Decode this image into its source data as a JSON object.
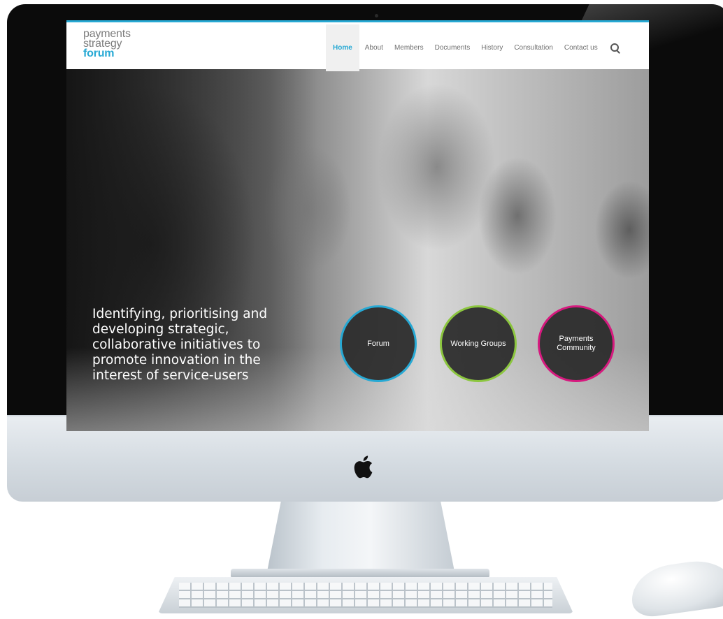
{
  "site": {
    "logo": {
      "line1": "payments",
      "line2": "strategy",
      "line3": "forum"
    },
    "nav": [
      {
        "label": "Home",
        "active": true
      },
      {
        "label": "About",
        "active": false
      },
      {
        "label": "Members",
        "active": false
      },
      {
        "label": "Documents",
        "active": false
      },
      {
        "label": "History",
        "active": false
      },
      {
        "label": "Consultation",
        "active": false
      },
      {
        "label": "Contact us",
        "active": false
      }
    ],
    "search_icon": "search-icon",
    "tagline": "Identifying, prioritising and developing strategic, collaborative initiatives to promote innovation in the interest of service-users",
    "circles": [
      {
        "label": "Forum",
        "color": "#27a9d4"
      },
      {
        "label": "Working Groups",
        "color": "#8cc63f"
      },
      {
        "label": "Payments\nCommunity",
        "color": "#d6197e"
      }
    ]
  },
  "colors": {
    "accent": "#27a9d4",
    "green": "#8cc63f",
    "magenta": "#d6197e"
  }
}
